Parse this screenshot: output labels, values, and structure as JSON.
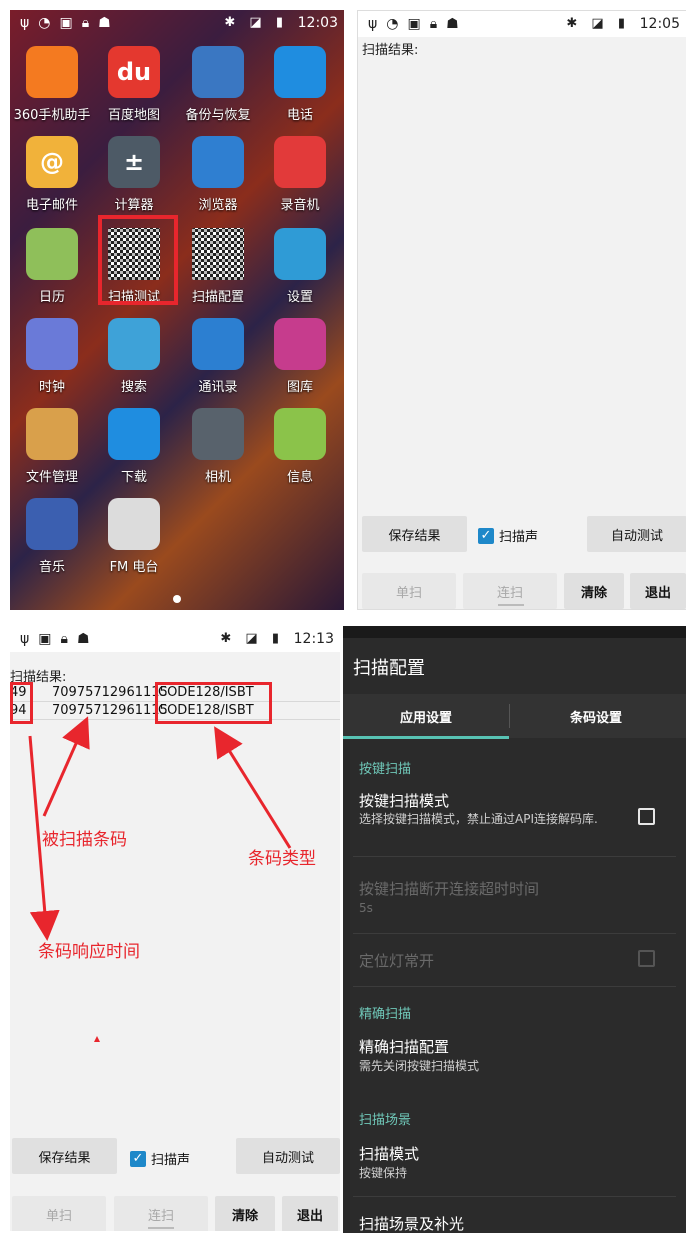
{
  "launcher": {
    "status": {
      "time": "12:03",
      "left_icons": [
        "usb-icon",
        "signal-icon",
        "sim-icon",
        "lock-icon",
        "android-icon"
      ]
    },
    "apps": [
      {
        "label": "360手机助手",
        "icon": "360-assistant-icon",
        "color": "#f47a20"
      },
      {
        "label": "百度地图",
        "icon": "baidu-map-icon",
        "color": "#e4382f",
        "glyph": "du"
      },
      {
        "label": "备份与恢复",
        "icon": "backup-clock-icon",
        "color": "#3a77c2"
      },
      {
        "label": "电话",
        "icon": "phone-icon",
        "color": "#1f8de0"
      },
      {
        "label": "电子邮件",
        "icon": "email-icon",
        "color": "#f1b23a",
        "glyph": "@"
      },
      {
        "label": "计算器",
        "icon": "calculator-icon",
        "color": "#4d5a66",
        "glyph": "±"
      },
      {
        "label": "浏览器",
        "icon": "browser-globe-icon",
        "color": "#2f7fd1"
      },
      {
        "label": "录音机",
        "icon": "recorder-icon",
        "color": "#e23a3a"
      },
      {
        "label": "日历",
        "icon": "calendar-icon",
        "color": "#8fbf5a"
      },
      {
        "label": "扫描测试",
        "icon": "qr-scan-test-icon",
        "color": "#ffffff"
      },
      {
        "label": "扫描配置",
        "icon": "qr-scan-config-icon",
        "color": "#ffffff"
      },
      {
        "label": "设置",
        "icon": "settings-gear-icon",
        "color": "#2f9bd6"
      },
      {
        "label": "时钟",
        "icon": "clock-icon",
        "color": "#6a7ad8"
      },
      {
        "label": "搜索",
        "icon": "search-icon",
        "color": "#3ea2d8"
      },
      {
        "label": "通讯录",
        "icon": "contacts-icon",
        "color": "#2c7fd1"
      },
      {
        "label": "图库",
        "icon": "gallery-icon",
        "color": "#c63c8d"
      },
      {
        "label": "文件管理",
        "icon": "file-manager-icon",
        "color": "#d9a04b"
      },
      {
        "label": "下载",
        "icon": "download-icon",
        "color": "#1f8de0"
      },
      {
        "label": "相机",
        "icon": "camera-icon",
        "color": "#58626c"
      },
      {
        "label": "信息",
        "icon": "messaging-icon",
        "color": "#8bc34a"
      },
      {
        "label": "音乐",
        "icon": "music-icon",
        "color": "#3b5fb0"
      },
      {
        "label": "FM 电台",
        "icon": "fm-radio-icon",
        "color": "#dcdcdc"
      }
    ]
  },
  "scan_test": {
    "status": {
      "time": "12:05"
    },
    "result_label": "扫描结果:",
    "save_label": "保存结果",
    "sound_label": "扫描声",
    "auto_label": "自动测试",
    "single_label": "单扫",
    "continuous_label": "连扫",
    "clear_label": "清除",
    "exit_label": "退出"
  },
  "scan_results": {
    "status": {
      "time": "12:13"
    },
    "result_label": "扫描结果:",
    "rows": [
      {
        "time": "49",
        "code": "70975712961115",
        "type": "CODE128/ISBT"
      },
      {
        "time": "94",
        "code": "70975712961115",
        "type": "CODE128/ISBT"
      }
    ],
    "annotations": {
      "barcode": "被扫描条码",
      "type": "条码类型",
      "response_time": "条码响应时间"
    },
    "save_label": "保存结果",
    "sound_label": "扫描声",
    "auto_label": "自动测试",
    "single_label": "单扫",
    "continuous_label": "连扫",
    "clear_label": "清除",
    "exit_label": "退出"
  },
  "scan_config": {
    "title": "扫描配置",
    "tabs": [
      "应用设置",
      "条码设置"
    ],
    "key_scan_section": "按键扫描",
    "key_scan_mode_title": "按键扫描模式",
    "key_scan_mode_desc": "选择按键扫描模式，禁止通过API连接解码库.",
    "disconnect_timeout_title": "按键扫描断开连接超时时间",
    "disconnect_timeout_value": "5s",
    "aim_light_title": "定位灯常开",
    "precise_section": "精确扫描",
    "precise_config_title": "精确扫描配置",
    "precise_config_desc": "需先关闭按键扫描模式",
    "scene_section": "扫描场景",
    "scan_mode_title": "扫描模式",
    "scan_mode_value": "按键保持",
    "scene_light_title": "扫描场景及补光"
  },
  "colors": {
    "accent_red": "#e8262d",
    "teal": "#58c3b4",
    "checkbox_blue": "#1e88c9"
  }
}
